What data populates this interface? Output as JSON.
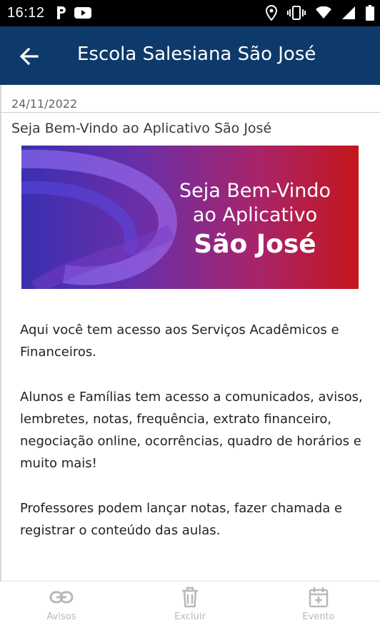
{
  "status_bar": {
    "time": "16:12"
  },
  "app_bar": {
    "title": "Escola Salesiana São José"
  },
  "post": {
    "date": "24/11/2022",
    "title": "Seja Bem-Vindo ao Aplicativo São José",
    "banner": {
      "line1": "Seja Bem-Vindo",
      "line2": "ao Aplicativo",
      "line3": "São José"
    },
    "paragraphs": [
      "Aqui você tem acesso aos Serviços Acadêmicos e Financeiros.",
      "Alunos e Famílias tem acesso a comunicados, avisos, lembretes, notas, frequência, extrato financeiro, negociação online, ocorrências, quadro de horários e muito mais!",
      "Professores podem lançar notas, fazer chamada e registrar o conteúdo das aulas."
    ]
  },
  "bottom_nav": {
    "avisos": "Avisos",
    "excluir": "Excluir",
    "evento": "Evento"
  },
  "colors": {
    "app_bar": "#0d3a6b",
    "status_bar": "#000000",
    "nav_disabled": "#b8b8b8"
  }
}
